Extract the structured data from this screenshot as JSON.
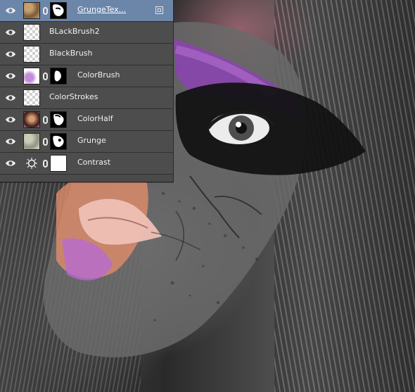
{
  "panel": {
    "layers": [
      {
        "name": "GrungeTex...",
        "active": true,
        "visible": true,
        "type": "texture",
        "has_mask": true,
        "mask": "black-face",
        "link": true
      },
      {
        "name": "BLackBrush2",
        "active": false,
        "visible": true,
        "type": "transparent",
        "has_mask": false,
        "link": false
      },
      {
        "name": "BlackBrush",
        "active": false,
        "visible": true,
        "type": "transparent",
        "has_mask": false,
        "link": false
      },
      {
        "name": "ColorBrush",
        "active": false,
        "visible": true,
        "type": "brush",
        "has_mask": true,
        "mask": "white-shape",
        "link": true
      },
      {
        "name": "ColorStrokes",
        "active": false,
        "visible": true,
        "type": "transparent",
        "has_mask": false,
        "link": false
      },
      {
        "name": "ColorHalf",
        "active": false,
        "visible": true,
        "type": "photo",
        "has_mask": true,
        "mask": "black-shape",
        "link": true
      },
      {
        "name": "Grunge",
        "active": false,
        "visible": true,
        "type": "texture2",
        "has_mask": true,
        "mask": "black-face2",
        "link": true
      },
      {
        "name": "Contrast",
        "active": false,
        "visible": true,
        "type": "adjustment",
        "has_mask": true,
        "mask": "white",
        "link": true
      }
    ],
    "icons": {
      "eye": "eye-icon",
      "link": "link-icon",
      "adjustment": "brightness-icon",
      "top_right": "layer-options-icon"
    }
  },
  "colors": {
    "panel_bg": "#4a4a4a",
    "active_row": "#6c86aa",
    "row_border": "#2f2f2f",
    "text": "#f0f0f0"
  }
}
